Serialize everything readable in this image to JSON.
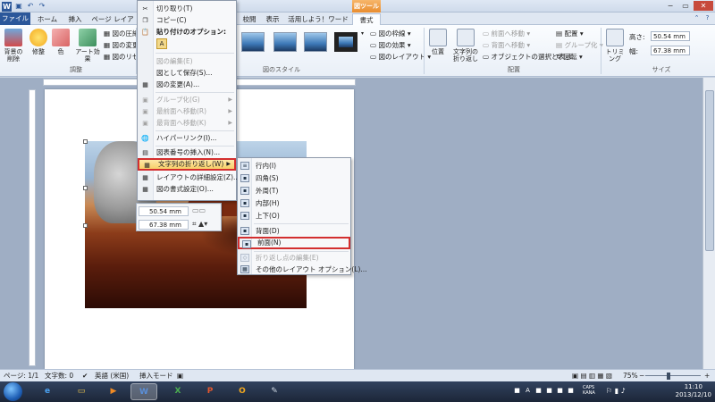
{
  "titlebar": {
    "qa_icons": [
      "save-icon",
      "undo-icon",
      "redo-icon"
    ],
    "picture_tools": "図ツール",
    "window_buttons": [
      "−",
      "▭",
      "✕"
    ]
  },
  "tabs": [
    {
      "label": "ファイル"
    },
    {
      "label": "ホーム"
    },
    {
      "label": "挿入"
    },
    {
      "label": "ページ レイアウト"
    },
    {
      "label": "校閲"
    },
    {
      "label": "表示"
    },
    {
      "label": "活用しよう！ワード"
    },
    {
      "label": "書式"
    }
  ],
  "ribbon": {
    "background_removal": "背景の\n削除",
    "corrections": "修整",
    "color": "色",
    "artistic": "アート効果",
    "compress": "図の圧縮",
    "change": "図の変更",
    "reset": "図のリセット",
    "group_adjust": "調整",
    "border": "図の枠線",
    "effects": "図の効果",
    "layout": "図のレイアウト",
    "group_styles": "図のスタイル",
    "position": "位置",
    "wrap": "文字列の\n折り返し",
    "bring_forward": "前面へ移動",
    "send_backward": "背面へ移動",
    "selection_pane": "オブジェクトの選択と表示",
    "align": "配置",
    "group": "グループ化",
    "rotate": "回転",
    "group_arrange": "配置",
    "crop": "トリミング",
    "height_label": "高さ:",
    "height_value": "50.54 mm",
    "width_label": "幅:",
    "width_value": "67.38 mm",
    "group_size": "サイズ"
  },
  "context_menu": {
    "cut": "切り取り(T)",
    "copy": "コピー(C)",
    "paste_header": "貼り付けのオプション:",
    "edit_picture": "図の編集(E)",
    "save_as_picture": "図として保存(S)...",
    "change_picture": "図の変更(A)...",
    "group": "グループ化(G)",
    "bring_to_front": "最前面へ移動(R)",
    "send_to_back": "最背面へ移動(K)",
    "hyperlink": "ハイパーリンク(I)...",
    "insert_caption": "図表番号の挿入(N)...",
    "wrap_text": "文字列の折り返し(W)",
    "more_layout": "レイアウトの詳細設定(Z)...",
    "format_picture": "図の書式設定(O)..."
  },
  "submenu": {
    "inline": "行内(I)",
    "square": "四角(S)",
    "tight": "外周(T)",
    "through": "内部(H)",
    "top_bottom": "上下(O)",
    "behind": "背面(D)",
    "in_front": "前面(N)",
    "edit_wrap_points": "折り返し点の編集(E)",
    "more_options": "その他のレイアウト オプション(L)..."
  },
  "mini_toolbar": {
    "height": "50.54 mm",
    "width": "67.38 mm"
  },
  "status": {
    "page": "ページ: 1/1",
    "words": "文字数: 0",
    "language": "英語 (米国)",
    "mode": "挿入モード",
    "zoom": "75%"
  },
  "taskbar": {
    "time": "11:10",
    "date": "2013/12/10",
    "ime": "CAPS\nKANA"
  },
  "colors": {
    "file_tab": "#2b579a",
    "picture_tools": "#e98c2e",
    "highlight_border": "#d32f2f"
  }
}
